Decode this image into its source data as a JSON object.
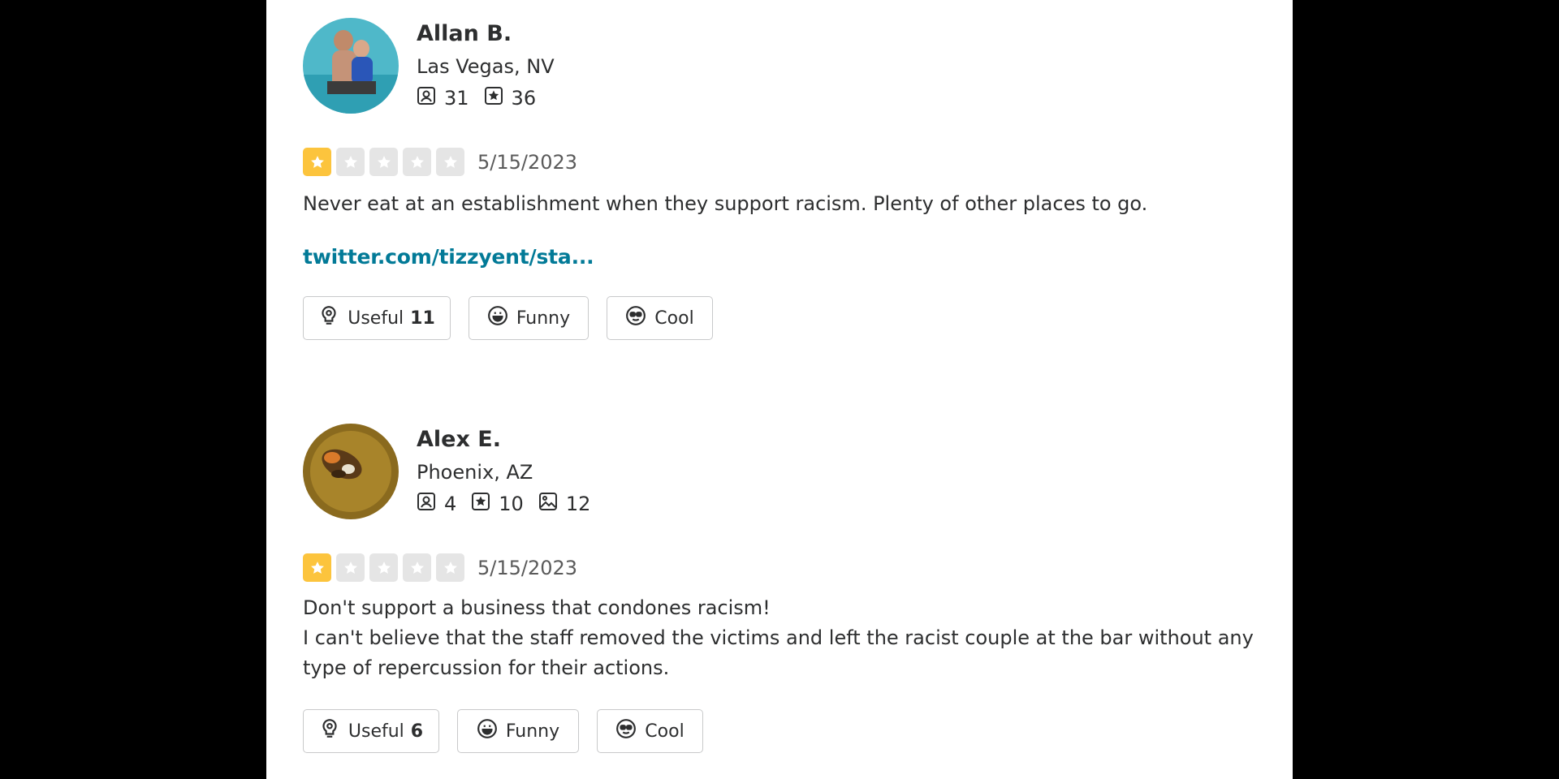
{
  "reviews": [
    {
      "user": {
        "name": "Allan B.",
        "location": "Las Vegas, NV",
        "stats": {
          "friends": "31",
          "reviews": "36"
        }
      },
      "rating": 1,
      "date": "5/15/2023",
      "text": "Never eat at an establishment when they support racism. Plenty of other places to go.",
      "link": "twitter.com/tizzyent/sta...",
      "reactions": {
        "useful_label": "Useful",
        "useful_count": "11",
        "funny_label": "Funny",
        "cool_label": "Cool"
      }
    },
    {
      "user": {
        "name": "Alex E.",
        "location": "Phoenix, AZ",
        "stats": {
          "friends": "4",
          "reviews": "10",
          "photos": "12"
        }
      },
      "rating": 1,
      "date": "5/15/2023",
      "text": "Don't support a business that condones racism!\nI can't believe that the staff removed the victims and left the racist couple at the bar without any type of repercussion for their actions.",
      "reactions": {
        "useful_label": "Useful",
        "useful_count": "6",
        "funny_label": "Funny",
        "cool_label": "Cool"
      }
    }
  ],
  "colors": {
    "star_on": "#fcc43d",
    "star_off": "#e5e5e5",
    "link": "#027a97"
  }
}
